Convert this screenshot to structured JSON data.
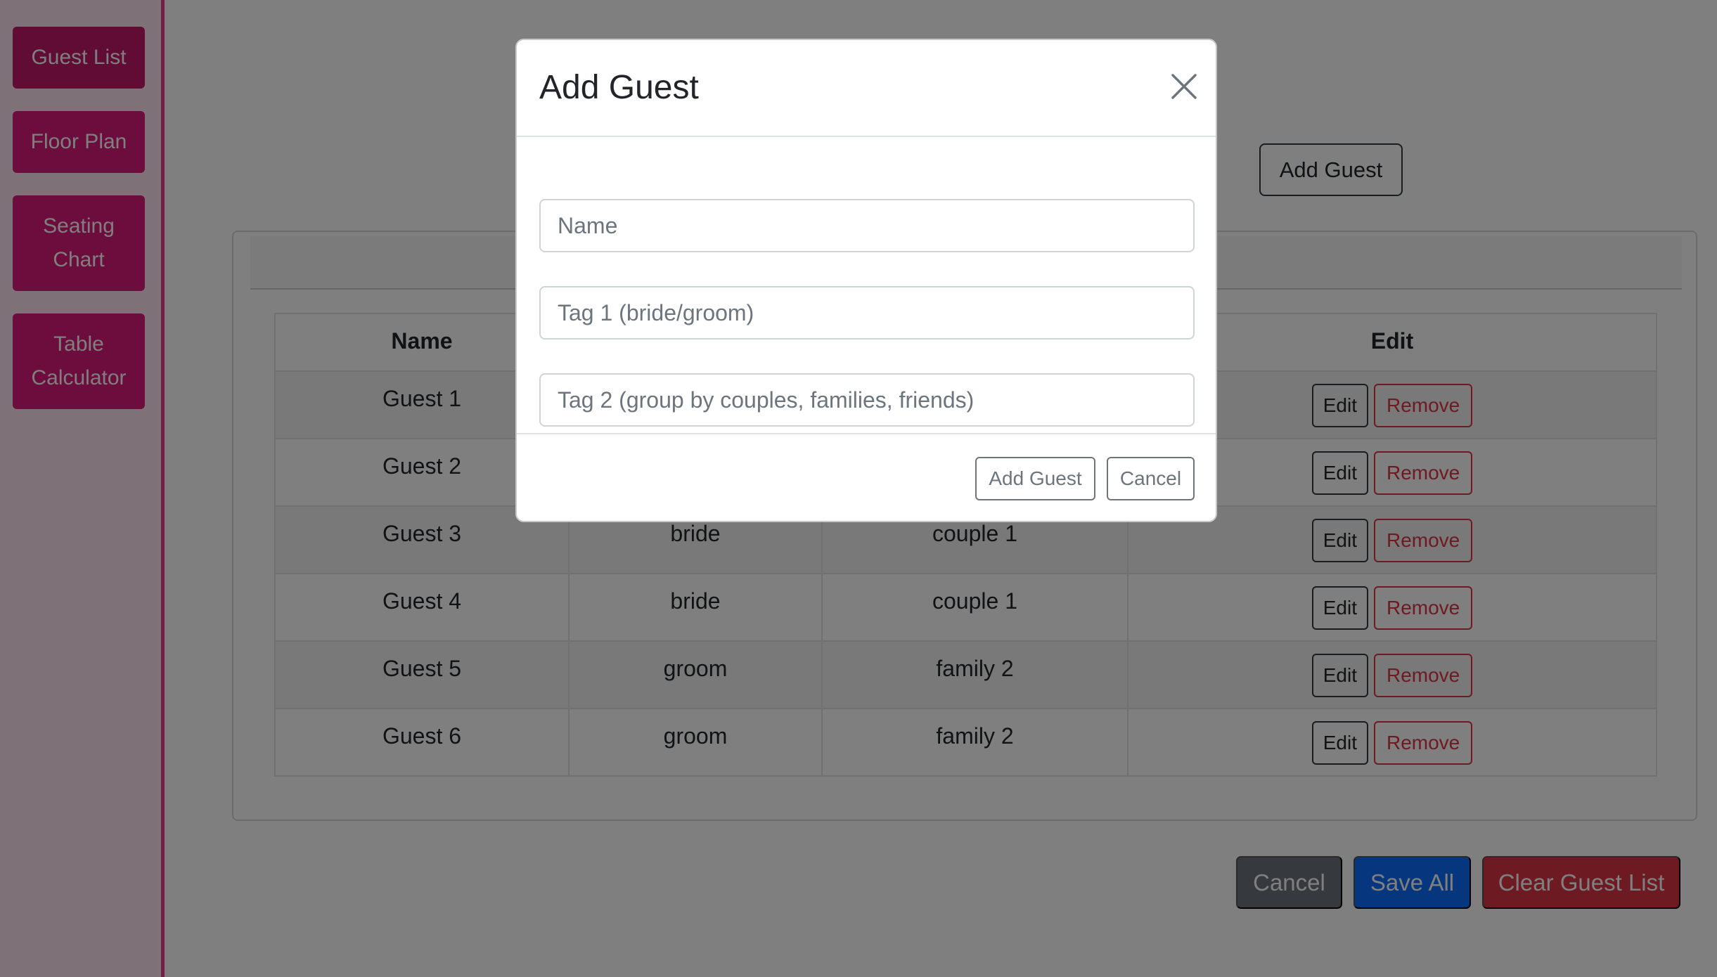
{
  "sidebar": {
    "items": [
      {
        "label": "Guest List"
      },
      {
        "label": "Floor Plan"
      },
      {
        "label": "Seating Chart"
      },
      {
        "label": "Table Calculator"
      }
    ]
  },
  "page": {
    "add_guest_label": "Add Guest"
  },
  "table": {
    "headers": {
      "name": "Name",
      "tag1": "",
      "tag2": "",
      "edit": "Edit"
    },
    "edit_label": "Edit",
    "remove_label": "Remove",
    "rows": [
      {
        "name": "Guest 1",
        "tag1": "",
        "tag2": ""
      },
      {
        "name": "Guest 2",
        "tag1": "",
        "tag2": ""
      },
      {
        "name": "Guest 3",
        "tag1": "bride",
        "tag2": "couple 1"
      },
      {
        "name": "Guest 4",
        "tag1": "bride",
        "tag2": "couple 1"
      },
      {
        "name": "Guest 5",
        "tag1": "groom",
        "tag2": "family 2"
      },
      {
        "name": "Guest 6",
        "tag1": "groom",
        "tag2": "family 2"
      }
    ]
  },
  "footer": {
    "cancel_label": "Cancel",
    "save_label": "Save All",
    "clear_label": "Clear Guest List"
  },
  "modal": {
    "title": "Add Guest",
    "name_placeholder": "Name",
    "tag1_placeholder": "Tag 1 (bride/groom)",
    "tag2_placeholder": "Tag 2 (group by couples, families, friends)",
    "add_label": "Add Guest",
    "cancel_label": "Cancel",
    "close_icon": "close-icon"
  },
  "colors": {
    "sidebar_bg": "#fde3ef",
    "accent_pink": "#d81b7a",
    "primary": "#0d6efd",
    "danger": "#dc3545",
    "secondary": "#6c757d"
  }
}
